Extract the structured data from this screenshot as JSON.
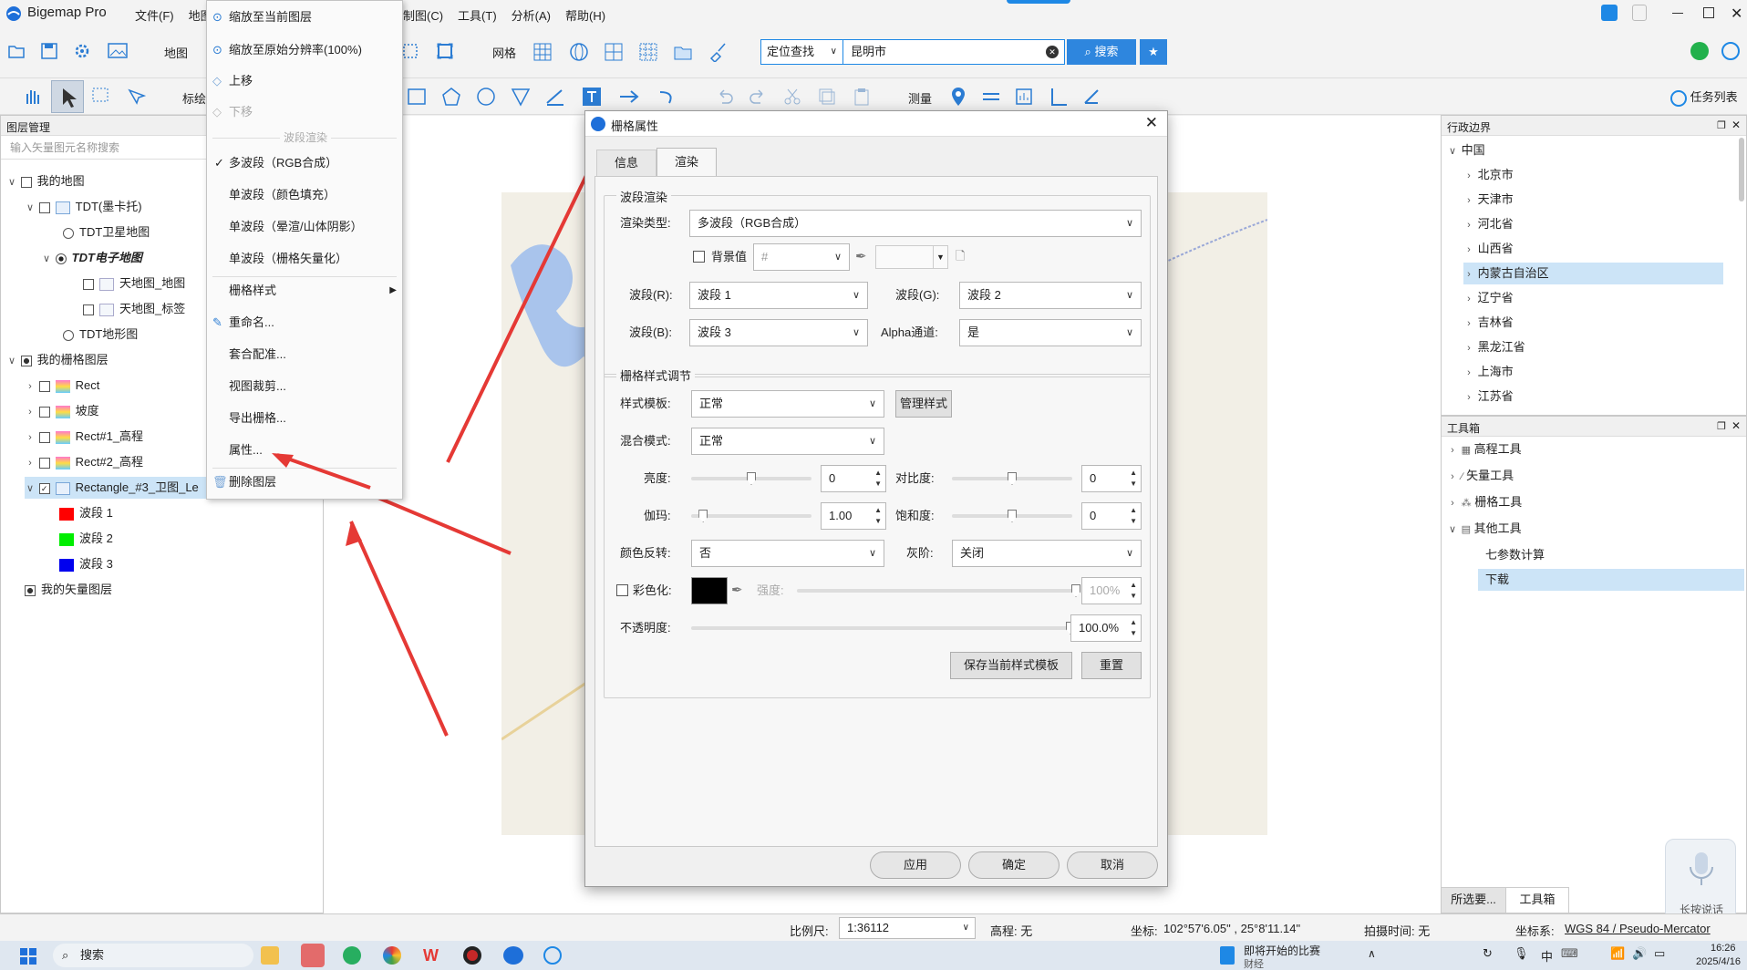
{
  "app": {
    "title": "Bigemap Pro"
  },
  "menu": {
    "left": [
      "文件(F)",
      "地图"
    ],
    "right": [
      "制图(C)",
      "工具(T)",
      "分析(A)",
      "帮助(H)"
    ]
  },
  "toolbar1": {
    "map_label": "地图",
    "grid_label": "网格",
    "locate_select": "定位查找",
    "search_value": "昆明市",
    "search_button": "搜索"
  },
  "toolbar2": {
    "mark_label": "标绘",
    "measure_label": "测量",
    "task_list": "任务列表"
  },
  "layer_panel": {
    "title": "图层管理",
    "search_placeholder": "输入矢量图元名称搜索",
    "items": [
      {
        "label": "我的地图"
      },
      {
        "label": "TDT(墨卡托)"
      },
      {
        "label": "TDT卫星地图"
      },
      {
        "label": "TDT电子地图"
      },
      {
        "label": "天地图_地图"
      },
      {
        "label": "天地图_标签"
      },
      {
        "label": "TDT地形图"
      },
      {
        "label": "我的栅格图层"
      },
      {
        "label": "Rect"
      },
      {
        "label": "坡度"
      },
      {
        "label": "Rect#1_高程"
      },
      {
        "label": "Rect#2_高程"
      },
      {
        "label": "Rectangle_#3_卫图_Le"
      },
      {
        "label": "波段 1",
        "color": "#ff0000"
      },
      {
        "label": "波段 2",
        "color": "#00ee00"
      },
      {
        "label": "波段 3",
        "color": "#0000ee"
      },
      {
        "label": "我的矢量图层"
      }
    ]
  },
  "context_menu": {
    "items": [
      "缩放至当前图层",
      "缩放至原始分辨率(100%)",
      "上移",
      "下移",
      "波段渲染",
      "多波段（RGB合成）",
      "单波段（颜色填充）",
      "单波段（晕渲/山体阴影）",
      "单波段（栅格矢量化）",
      "栅格样式",
      "重命名...",
      "套合配准...",
      "视图裁剪...",
      "导出栅格...",
      "属性...",
      "删除图层"
    ]
  },
  "dialog": {
    "title": "栅格属性",
    "tabs": [
      "信息",
      "渲染"
    ],
    "group1_title": "波段渲染",
    "render_type_label": "渲染类型:",
    "render_type_value": "多波段（RGB合成）",
    "bg_label": "背景值",
    "bg_value": "#",
    "band_r_label": "波段(R):",
    "band_r_value": "波段 1",
    "band_g_label": "波段(G):",
    "band_g_value": "波段 2",
    "band_b_label": "波段(B):",
    "band_b_value": "波段 3",
    "alpha_label": "Alpha通道:",
    "alpha_value": "是",
    "group2_title": "栅格样式调节",
    "style_template_label": "样式模板:",
    "style_template_value": "正常",
    "manage_style": "管理样式",
    "blend_label": "混合模式:",
    "blend_value": "正常",
    "brightness_label": "亮度:",
    "brightness_value": "0",
    "contrast_label": "对比度:",
    "contrast_value": "0",
    "gamma_label": "伽玛:",
    "gamma_value": "1.00",
    "saturation_label": "饱和度:",
    "saturation_value": "0",
    "invert_label": "颜色反转:",
    "invert_value": "否",
    "grayscale_label": "灰阶:",
    "grayscale_value": "关闭",
    "colorize_label": "彩色化:",
    "strength_label": "强度:",
    "strength_value": "100%",
    "opacity_label": "不透明度:",
    "opacity_value": "100.0%",
    "save_template": "保存当前样式模板",
    "reset": "重置",
    "apply": "应用",
    "ok": "确定",
    "cancel": "取消",
    "levels": {
      "brightness": 0.5,
      "contrast": 0.5,
      "gamma": 0.1,
      "saturation": 0.5,
      "strength": 1.0,
      "opacity": 1.0
    }
  },
  "admin_panel": {
    "title": "行政边界",
    "root": "中国",
    "items": [
      "北京市",
      "天津市",
      "河北省",
      "山西省",
      "内蒙古自治区",
      "辽宁省",
      "吉林省",
      "黑龙江省",
      "上海市",
      "江苏省"
    ],
    "selected": "内蒙古自治区"
  },
  "toolbox_panel": {
    "title": "工具箱",
    "items": [
      "高程工具",
      "矢量工具",
      "栅格工具",
      "其他工具"
    ],
    "sub_items": [
      "七参数计算",
      "下载"
    ],
    "selected": "下载",
    "tabs": [
      "所选要...",
      "工具箱"
    ]
  },
  "status": {
    "scale_label": "比例尺:",
    "scale_value": "1:36112",
    "elev_label": "高程: 无",
    "coord_label": "坐标:",
    "coord_value": "102°57'6.05\" , 25°8'11.14\"",
    "capture_label": "拍摄时间: 无",
    "crs_label": "坐标系:",
    "crs_value": "WGS 84 / Pseudo-Mercator"
  },
  "voice": {
    "label": "长按说话"
  },
  "taskbar": {
    "search": "搜索",
    "news": "即将开始的比赛",
    "news_sub": "财经",
    "time": "16:26",
    "date": "2025/4/16",
    "ime": "中"
  },
  "colors": {
    "accent": "#1e88e5",
    "selected": "#cce4f7",
    "arrow": "#e53935"
  }
}
